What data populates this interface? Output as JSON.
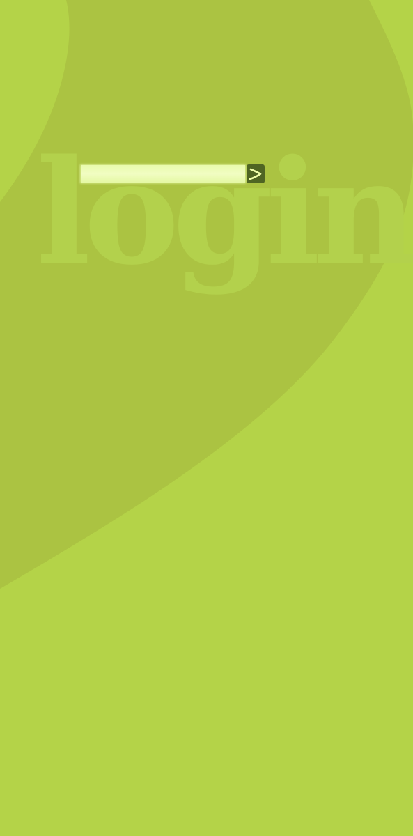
{
  "page": {
    "watermark_text": "login",
    "colors": {
      "background": "#b4d348",
      "swoosh": "#abc342",
      "watermark": "#b3d14c",
      "input_fill": "#ecfbb4",
      "submit_button": "#4f6523",
      "submit_arrow": "#eefca8"
    }
  },
  "login": {
    "input_value": "",
    "submit_icon": "chevron-right-arrow-icon"
  }
}
